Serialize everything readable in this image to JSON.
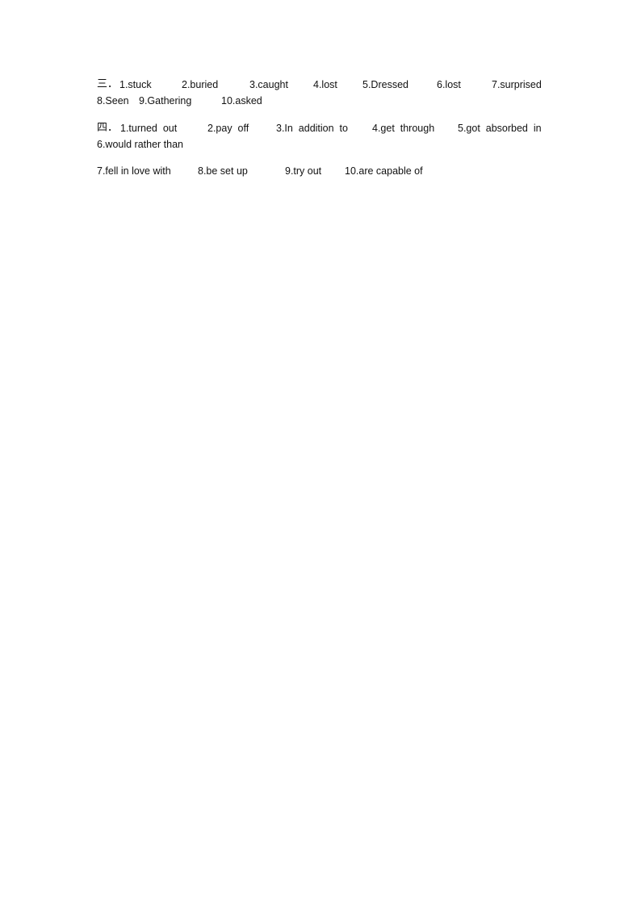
{
  "section3": {
    "marker": "三．",
    "answers": [
      "1.stuck",
      "2.buried",
      "3.caught",
      "4.lost",
      "5.Dressed",
      "6.lost",
      "7.surprised",
      "8.Seen",
      "9.Gathering",
      "10.asked"
    ]
  },
  "section4": {
    "marker": "四．",
    "answers": [
      "1.turned  out",
      "2.pay  off",
      "3.In  addition  to",
      "4.get  through",
      "5.got  absorbed  in",
      "6.would rather than",
      "7.fell in love with",
      "8.be set up",
      "9.try out",
      "10.are capable of"
    ]
  }
}
